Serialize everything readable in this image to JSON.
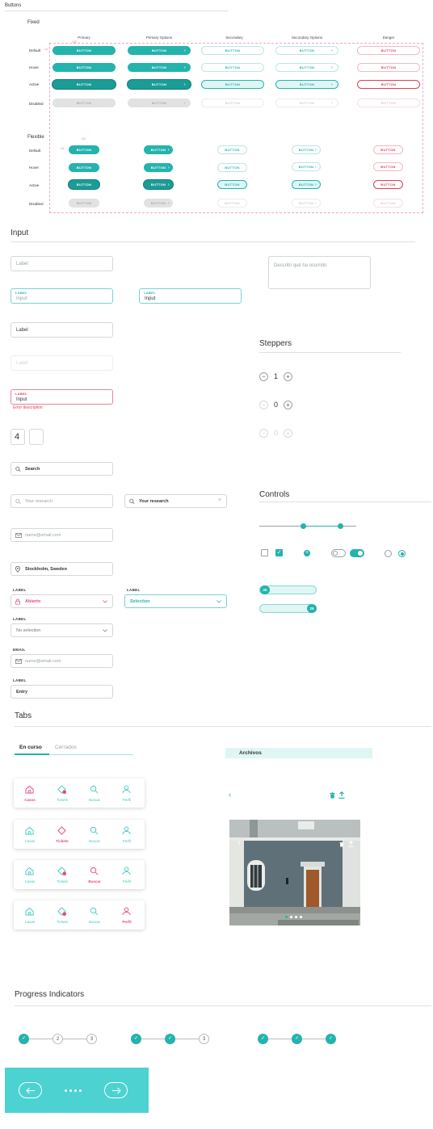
{
  "page_header": "Buttons",
  "buttons": {
    "fixed_title": "Fixed",
    "flexible_title": "Flexible",
    "columns": [
      "Primary",
      "Primary Options",
      "Secondary",
      "Secondary Options",
      "Danger"
    ],
    "rows": [
      "Default",
      "Hover",
      "Active",
      "Disabled"
    ],
    "button_label": "BUTTON",
    "dim_width": "132",
    "dim_height": "14",
    "dim_flex_width": "1/2"
  },
  "input": {
    "title": "Input",
    "label_placeholder": "Label",
    "float_label": "LABEL",
    "input_placeholder": "Input",
    "input_value": "Input",
    "textarea_placeholder": "Describí qué ha ocurrido",
    "plain_label": "Label",
    "disabled_placeholder": "Label",
    "error_label": "LABEL",
    "error_value": "Input",
    "error_description": "Error description",
    "code_digit": "4",
    "search_label": "Search",
    "research_placeholder": "Your research",
    "research_value": "Your research",
    "email_placeholder": "name@email.com",
    "location_value": "Stockholm, Sweden",
    "select_label": "LABEL",
    "select_error_value": "Abierto",
    "select_value": "Selection",
    "select_empty": "No selection",
    "email_label": "EMAIL",
    "entry_label": "LABEL",
    "entry_value": "Entry"
  },
  "steppers": {
    "title": "Steppers",
    "values": [
      "1",
      "0",
      "0"
    ]
  },
  "controls": {
    "title": "Controls",
    "slider_values": [
      "20",
      "29"
    ]
  },
  "tabs": {
    "title": "Tabs",
    "tab_active": "En curso",
    "tab_inactive": "Cerrados",
    "nav_items": [
      "Casos",
      "Tickets",
      "Buscar",
      "Perfil"
    ],
    "archive_title": "Archivos",
    "colors": {
      "accent": "#24b3ad",
      "active": "#e74876",
      "danger": "#e03d55"
    }
  },
  "progress": {
    "title": "Progress Indicators",
    "steps": [
      "1",
      "2",
      "3"
    ]
  }
}
